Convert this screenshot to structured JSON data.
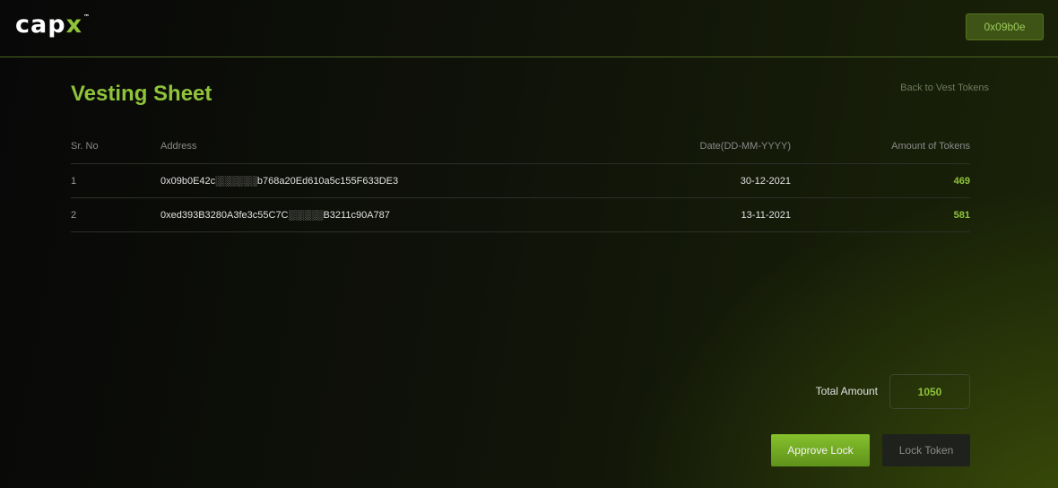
{
  "header": {
    "logo_main": "cap",
    "logo_accent": "x",
    "logo_tm": "™",
    "wallet_label": "0x09b0e"
  },
  "page": {
    "title": "Vesting Sheet",
    "back_link": "Back to Vest Tokens"
  },
  "table": {
    "headers": [
      "Sr. No",
      "Address",
      "Date(DD-MM-YYYY)",
      "Amount of Tokens"
    ],
    "rows": [
      {
        "sr": "1",
        "address": "0x09b0E42c░░░░░░b768a20Ed610a5c155F633DE3",
        "date": "30-12-2021",
        "amount": "469"
      },
      {
        "sr": "2",
        "address": "0xed393B3280A3fe3c55C7C░░░░░B3211c90A787",
        "date": "13-11-2021",
        "amount": "581"
      }
    ]
  },
  "summary": {
    "total_label": "Total Amount",
    "total_value": "1050"
  },
  "actions": {
    "approve_label": "Approve Lock",
    "lock_label": "Lock Token"
  },
  "colors": {
    "accent": "#8fc33a",
    "background": "#0c0e08"
  }
}
